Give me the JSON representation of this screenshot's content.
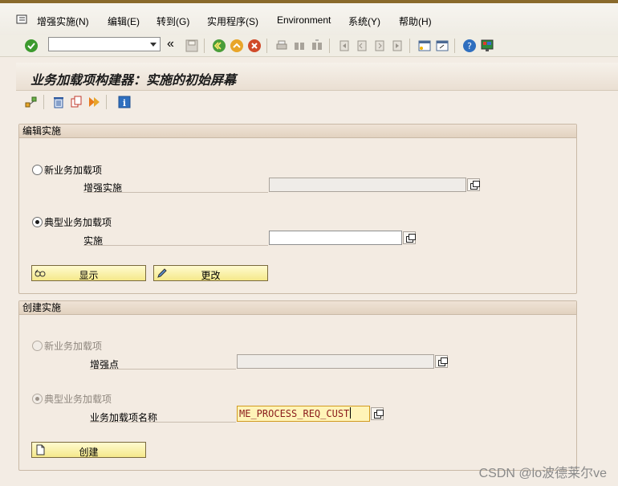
{
  "menubar": {
    "items": [
      "增强实施(N)",
      "编辑(E)",
      "转到(G)",
      "实用程序(S)",
      "Environment",
      "系统(Y)",
      "帮助(H)"
    ]
  },
  "toolbar": {
    "command_field_value": "",
    "icons": [
      "check-icon",
      "back-icon",
      "save-icon",
      "back-green-icon",
      "exit-yellow-icon",
      "cancel-red-icon",
      "print-icon",
      "find-icon",
      "find-next-icon",
      "first-page-icon",
      "prev-page-icon",
      "next-page-icon",
      "last-page-icon",
      "new-session-icon",
      "shortcut-icon",
      "help-icon",
      "layout-icon"
    ]
  },
  "title": "业务加载项构建器：实施的初始屏幕",
  "app_toolbar": {
    "icons": [
      "hierarchy-icon",
      "delete-icon",
      "copy-icon",
      "activate-icon",
      "info-icon"
    ]
  },
  "edit_group": {
    "title": "编辑实施",
    "option_new_label": "新业务加载项",
    "field_enh_label": "增强实施",
    "field_enh_value": "",
    "option_classic_label": "典型业务加载项",
    "field_impl_label": "实施",
    "field_impl_value": "",
    "display_button": "显示",
    "change_button": "更改"
  },
  "create_group": {
    "title": "创建实施",
    "option_new_label": "新业务加载项",
    "field_spot_label": "增强点",
    "field_spot_value": "",
    "option_classic_label": "典型业务加载项",
    "field_badi_label": "业务加载项名称",
    "field_badi_value": "ME_PROCESS_REQ_CUST",
    "create_button": "创建"
  },
  "watermark": "CSDN @lo波德莱尔ve",
  "colors": {
    "button_fill": "#f5e88a",
    "background": "#f3ece4",
    "highlight_field": "#fff4b8"
  }
}
